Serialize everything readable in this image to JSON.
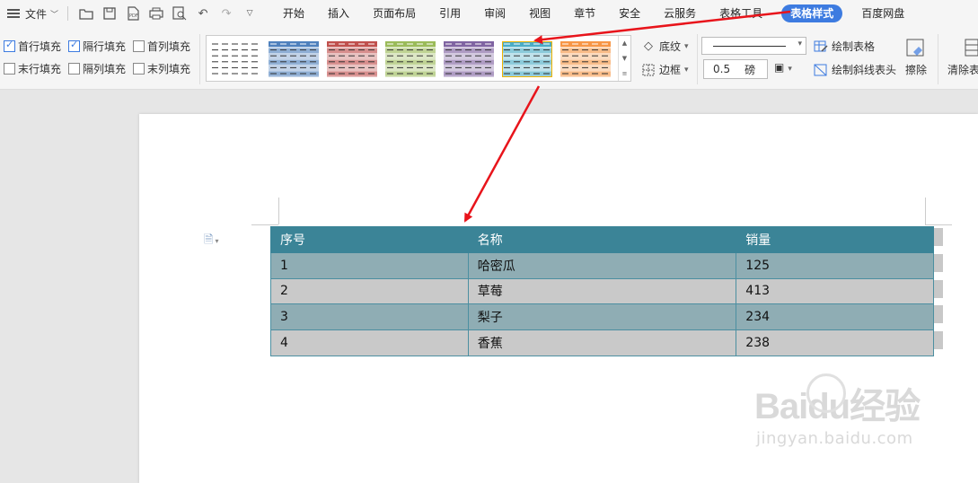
{
  "menubar": {
    "file_label": "文件",
    "tabs": [
      "开始",
      "插入",
      "页面布局",
      "引用",
      "审阅",
      "视图",
      "章节",
      "安全",
      "云服务",
      "表格工具",
      "表格样式",
      "百度网盘"
    ],
    "active_tab": "表格样式"
  },
  "ribbon": {
    "checkboxes": [
      {
        "label": "首行填充",
        "checked": true
      },
      {
        "label": "隔行填充",
        "checked": true
      },
      {
        "label": "首列填充",
        "checked": false
      },
      {
        "label": "末行填充",
        "checked": false
      },
      {
        "label": "隔列填充",
        "checked": false
      },
      {
        "label": "末列填充",
        "checked": false
      }
    ],
    "style_colors": [
      "#ffffff",
      "#4f81bd",
      "#c0504d",
      "#9bbb59",
      "#8064a2",
      "#4bacc6",
      "#f79646"
    ],
    "shading_label": "底纹",
    "border_label": "边框",
    "line_width": "0.5",
    "line_unit": "磅",
    "draw_table_label": "绘制表格",
    "draw_diagonal_label": "绘制斜线表头",
    "erase_label": "擦除",
    "clear_label": "清除表"
  },
  "table": {
    "headers": [
      "序号",
      "名称",
      "销量"
    ],
    "rows": [
      [
        "1",
        "哈密瓜",
        "125"
      ],
      [
        "2",
        "草莓",
        "413"
      ],
      [
        "3",
        "梨子",
        "234"
      ],
      [
        "4",
        "香蕉",
        "238"
      ]
    ]
  },
  "watermark": {
    "brand": "Baidu经验",
    "url": "jingyan.baidu.com"
  },
  "colors": {
    "accent": "#3d7be0",
    "table_header": "#3b8497",
    "row_odd": "#8fadb4",
    "row_even": "#c9c9c9",
    "annotation_arrow": "#e8141b"
  }
}
